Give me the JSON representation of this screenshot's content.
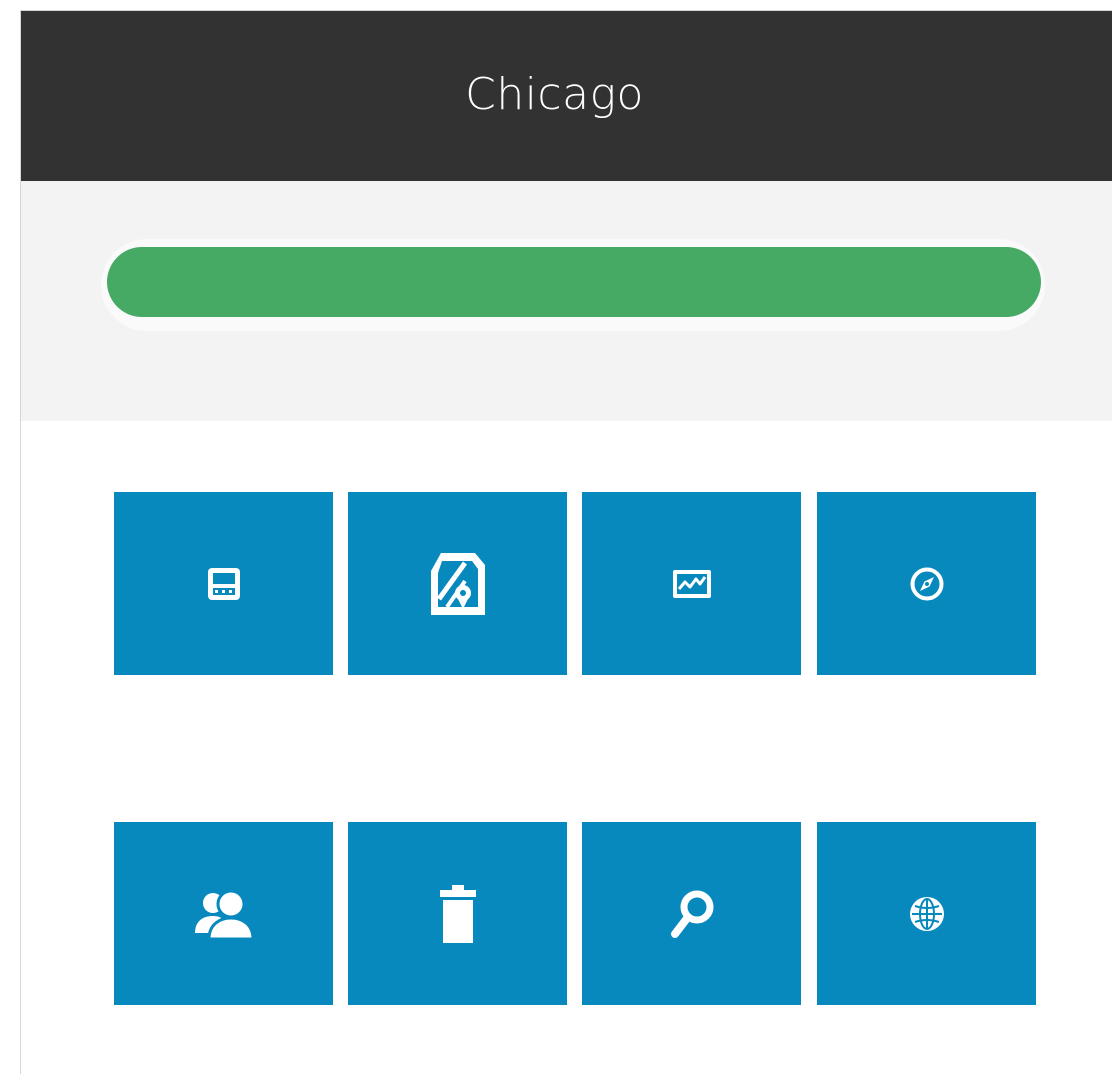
{
  "header": {
    "title": "Chicago"
  },
  "progress": {
    "value": 1.0
  },
  "colors": {
    "header_bg": "#323232",
    "band_bg": "#f3f3f3",
    "progress": "#46aa64",
    "tile": "#0789bd",
    "icon": "#ffffff"
  },
  "tiles": [
    {
      "icon": "widget-screen-icon"
    },
    {
      "icon": "map-pin-icon"
    },
    {
      "icon": "chart-line-icon"
    },
    {
      "icon": "compass-icon"
    },
    {
      "icon": "users-icon"
    },
    {
      "icon": "trash-icon"
    },
    {
      "icon": "search-icon"
    },
    {
      "icon": "globe-icon"
    }
  ]
}
